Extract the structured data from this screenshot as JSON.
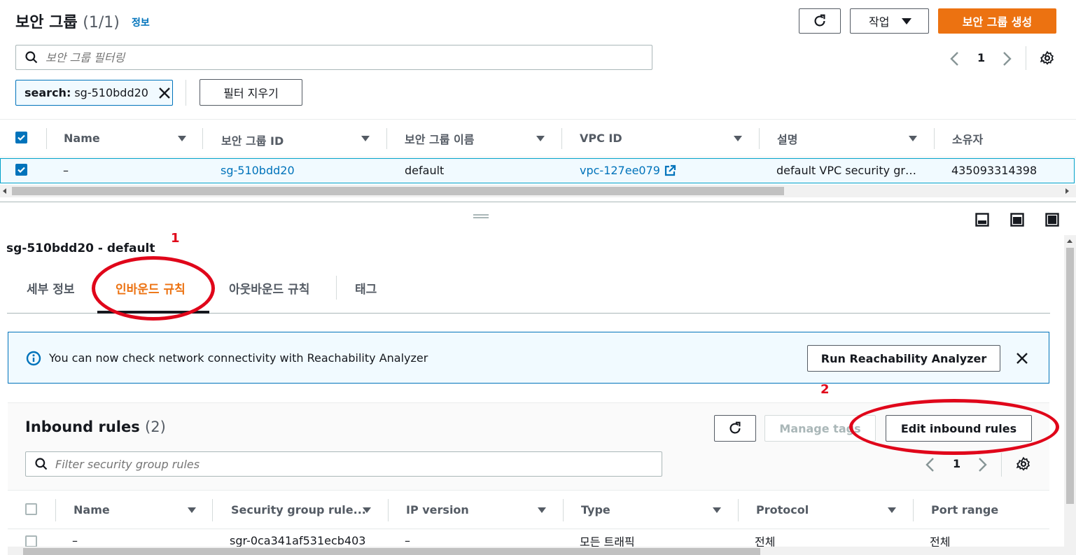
{
  "top_panel": {
    "title": "보안 그룹",
    "count": "(1/1)",
    "info_link": "정보",
    "actions_label": "작업",
    "create_label": "보안 그룹 생성",
    "filter_placeholder": "보안 그룹 필터링",
    "page": "1",
    "token_key": "search:",
    "token_value": "sg-510bdd20",
    "clear_filters_label": "필터 지우기",
    "columns": [
      "Name",
      "보안 그룹 ID",
      "보안 그룹 이름",
      "VPC ID",
      "설명",
      "소유자"
    ],
    "row": {
      "name": "–",
      "sg_id": "sg-510bdd20",
      "sg_name": "default",
      "vpc_id": "vpc-127ee079",
      "description": "default VPC security gr…",
      "owner": "435093314398"
    }
  },
  "detail": {
    "heading": "sg-510bdd20 - default",
    "tabs": [
      "세부 정보",
      "인바운드 규칙",
      "아웃바운드 규칙",
      "태그"
    ],
    "active_tab": 1,
    "info_alert": "You can now check network connectivity with Reachability Analyzer",
    "run_analyzer_label": "Run Reachability Analyzer",
    "annotation_1": "1",
    "annotation_2": "2"
  },
  "inbound": {
    "title": "Inbound rules",
    "count": "(2)",
    "manage_tags_label": "Manage tags",
    "edit_label": "Edit inbound rules",
    "filter_placeholder": "Filter security group rules",
    "page": "1",
    "columns": [
      "Name",
      "Security group rule...",
      "IP version",
      "Type",
      "Protocol",
      "Port range"
    ],
    "row": {
      "name": "–",
      "rule_id": "sgr-0ca341af531ecb403",
      "ip_version": "–",
      "type": "모든 트래픽",
      "protocol": "전체",
      "port_range": "전체"
    }
  },
  "colors": {
    "accent": "#0073bb",
    "primary": "#ec7211",
    "annotation": "#e0061a"
  }
}
